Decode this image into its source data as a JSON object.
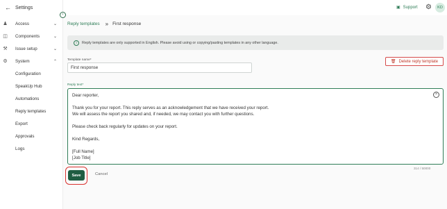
{
  "sidebar": {
    "back_label": "Settings",
    "items": [
      {
        "label": "Access",
        "icon": "users-icon"
      },
      {
        "label": "Components",
        "icon": "database-icon"
      },
      {
        "label": "Issue setup",
        "icon": "wrench-icon"
      },
      {
        "label": "System",
        "icon": "gear-icon"
      }
    ],
    "system_sub": [
      "Configuration",
      "SpeakUp Hub",
      "Automations",
      "Reply templates",
      "Export",
      "Approvals",
      "Logs"
    ]
  },
  "header": {
    "support_label": "Support",
    "avatar_initials": "KD"
  },
  "breadcrumb": {
    "parent": "Reply templates",
    "current": "First response"
  },
  "banner": {
    "text": "Reply templates are only supported in English. Please avoid using or copying/pasting templates in any other language."
  },
  "form": {
    "name_label": "Template name*",
    "name_value": "First response",
    "delete_label": "Delete reply template",
    "reply_label": "Reply text*",
    "reply_lines": [
      "Dear reporter,",
      "",
      "Thank you for your report. This reply serves as an acknowledgement that we have received your report.",
      "We will assess the report you shared and, if needed, we may contact you with further questions.",
      "",
      "Please check back regularly for updates on your report.",
      "",
      "Kind Regards,",
      "",
      "[Full Name]",
      "[Job Title]"
    ],
    "char_count": "314 / 50000",
    "save_label": "Save",
    "cancel_label": "Cancel"
  },
  "colors": {
    "accent": "#2f7d57",
    "save_bg": "#1f5d42",
    "danger": "#d64a4a"
  }
}
